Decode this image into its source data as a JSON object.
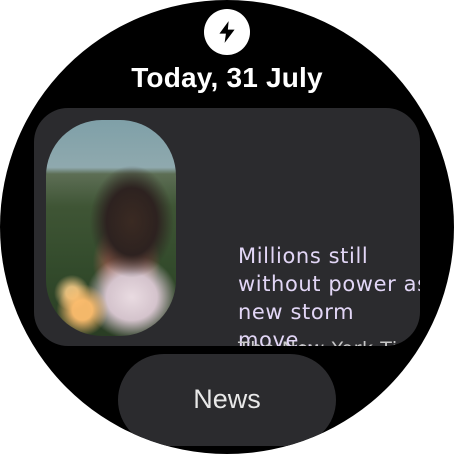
{
  "header": {
    "app_icon": "lightning-bolt-icon",
    "date": "Today, 31 July"
  },
  "card": {
    "headline": "Millions still\nwithout power as\nnew storm move...",
    "source": "The New York Ti...",
    "thumbnail": "news-article-photo"
  },
  "footer": {
    "button_label": "News"
  },
  "colors": {
    "background": "#000000",
    "card": "#2b2b2e",
    "headline": "#e2d6f6",
    "source": "#c8c8c8",
    "text": "#ffffff"
  }
}
